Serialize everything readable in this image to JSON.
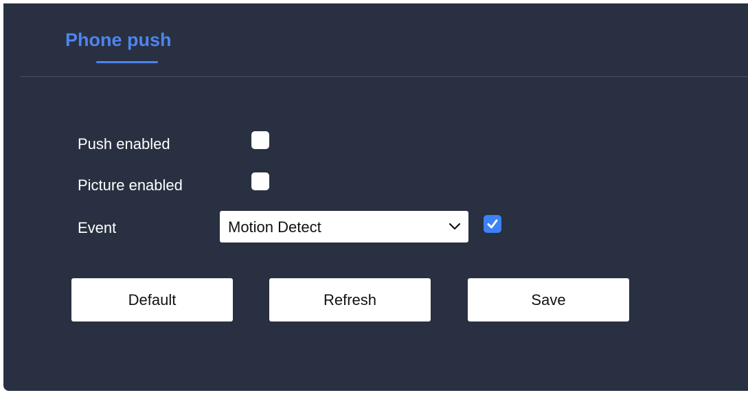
{
  "tabs": [
    {
      "label": "Phone push",
      "active": true
    }
  ],
  "form": {
    "push_enabled": {
      "label": "Push enabled",
      "checked": false
    },
    "picture_enabled": {
      "label": "Picture enabled",
      "checked": false
    },
    "event": {
      "label": "Event",
      "selected": "Motion Detect",
      "checked": true
    }
  },
  "buttons": {
    "default_label": "Default",
    "refresh_label": "Refresh",
    "save_label": "Save"
  },
  "colors": {
    "panel_bg": "#283041",
    "accent": "#4f84ee",
    "checkbox_checked": "#3c82f6"
  },
  "icons": {
    "dropdown": "chevron-down-icon",
    "checked_mark": "checkmark-icon"
  }
}
